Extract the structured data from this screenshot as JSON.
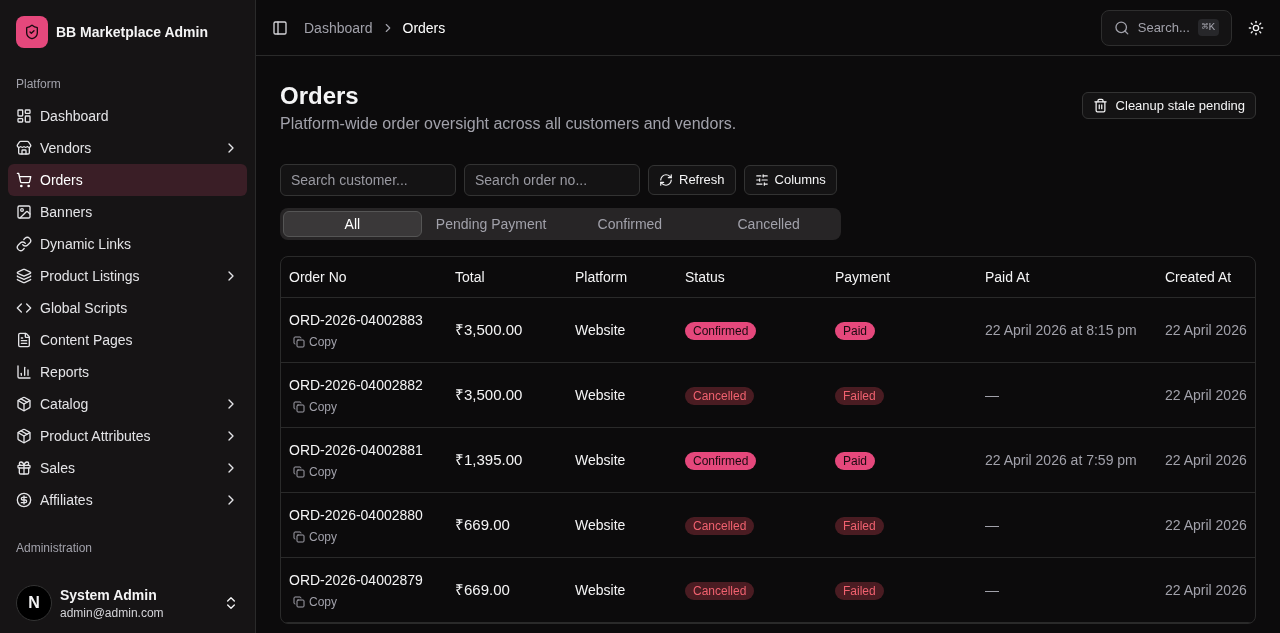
{
  "sidebar": {
    "brand": "BB Marketplace Admin",
    "sections": [
      {
        "label": "Platform",
        "items": [
          {
            "label": "Dashboard",
            "selected": false,
            "submenu": false
          },
          {
            "label": "Vendors",
            "selected": false,
            "submenu": true
          },
          {
            "label": "Orders",
            "selected": true,
            "submenu": false
          },
          {
            "label": "Banners",
            "selected": false,
            "submenu": false
          },
          {
            "label": "Dynamic Links",
            "selected": false,
            "submenu": false
          },
          {
            "label": "Product Listings",
            "selected": false,
            "submenu": true
          },
          {
            "label": "Global Scripts",
            "selected": false,
            "submenu": false
          },
          {
            "label": "Content Pages",
            "selected": false,
            "submenu": false
          },
          {
            "label": "Reports",
            "selected": false,
            "submenu": false
          },
          {
            "label": "Catalog",
            "selected": false,
            "submenu": true
          },
          {
            "label": "Product Attributes",
            "selected": false,
            "submenu": true
          },
          {
            "label": "Sales",
            "selected": false,
            "submenu": true
          },
          {
            "label": "Affiliates",
            "selected": false,
            "submenu": true
          }
        ]
      }
    ],
    "admin_label": "Administration",
    "user": {
      "avatar": "N",
      "name": "System Admin",
      "email": "admin@admin.com"
    }
  },
  "topbar": {
    "breadcrumbs": [
      "Dashboard",
      "Orders"
    ],
    "search": {
      "placeholder": "Search...",
      "shortcut": "⌘K"
    }
  },
  "page": {
    "title": "Orders",
    "subtitle": "Platform-wide order oversight across all customers and vendors.",
    "action": "Cleanup stale pending"
  },
  "filters": {
    "customer": {
      "placeholder": "Search customer..."
    },
    "order": {
      "placeholder": "Search order no..."
    },
    "buttons": [
      "Refresh",
      "Columns"
    ]
  },
  "tabs": [
    {
      "label": "All",
      "selected": true
    },
    {
      "label": "Pending Payment",
      "selected": false
    },
    {
      "label": "Confirmed",
      "selected": false
    },
    {
      "label": "Cancelled",
      "selected": false
    }
  ],
  "table": {
    "columns": [
      "Order No",
      "Total",
      "Platform",
      "Status",
      "Payment",
      "Paid At",
      "Created At"
    ],
    "rows": [
      {
        "order_no": "ORD-2026-04002883",
        "copy_label": "Copy",
        "total": "₹3,500.00",
        "platform": "Website",
        "status": {
          "label": "Confirmed",
          "kind": "success"
        },
        "payment": {
          "label": "Paid",
          "kind": "success"
        },
        "paid_at": "22 April 2026 at 8:15 pm",
        "created_at": "22 April 2026"
      },
      {
        "order_no": "ORD-2026-04002882",
        "copy_label": "Copy",
        "total": "₹3,500.00",
        "platform": "Website",
        "status": {
          "label": "Cancelled",
          "kind": "danger"
        },
        "payment": {
          "label": "Failed",
          "kind": "danger"
        },
        "paid_at": "—",
        "created_at": "22 April 2026"
      },
      {
        "order_no": "ORD-2026-04002881",
        "copy_label": "Copy",
        "total": "₹1,395.00",
        "platform": "Website",
        "status": {
          "label": "Confirmed",
          "kind": "success"
        },
        "payment": {
          "label": "Paid",
          "kind": "success"
        },
        "paid_at": "22 April 2026 at 7:59 pm",
        "created_at": "22 April 2026"
      },
      {
        "order_no": "ORD-2026-04002880",
        "copy_label": "Copy",
        "total": "₹669.00",
        "platform": "Website",
        "status": {
          "label": "Cancelled",
          "kind": "danger"
        },
        "payment": {
          "label": "Failed",
          "kind": "danger"
        },
        "paid_at": "—",
        "created_at": "22 April 2026"
      },
      {
        "order_no": "ORD-2026-04002879",
        "copy_label": "Copy",
        "total": "₹669.00",
        "platform": "Website",
        "status": {
          "label": "Cancelled",
          "kind": "danger"
        },
        "payment": {
          "label": "Failed",
          "kind": "danger"
        },
        "paid_at": "—",
        "created_at": "22 April 2026"
      }
    ]
  }
}
